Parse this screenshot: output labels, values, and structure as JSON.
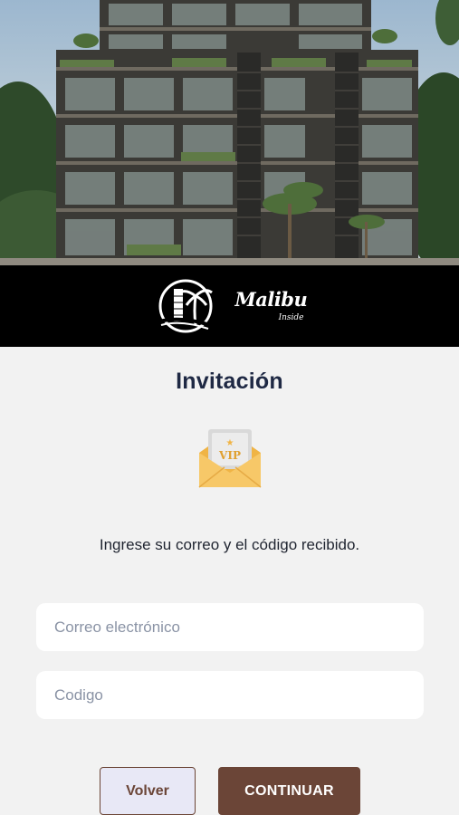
{
  "hero": {
    "image": "building-render"
  },
  "brand": {
    "logo_icon": "palm-building-logo-icon",
    "name": "Malibu",
    "tagline": "Inside"
  },
  "invitation": {
    "title": "Invitación",
    "icon": "vip-envelope-icon",
    "icon_text": "VIP",
    "instructions": "Ingrese su correo y el código recibido."
  },
  "form": {
    "email": {
      "value": "",
      "placeholder": "Correo electrónico"
    },
    "code": {
      "value": "",
      "placeholder": "Codigo"
    }
  },
  "actions": {
    "back_label": "Volver",
    "continue_label": "CONTINUAR"
  },
  "colors": {
    "accent": "#6b4537",
    "title": "#1f2944",
    "background": "#f2f2f2",
    "brand_bar": "#000000",
    "envelope": "#f5c05a"
  }
}
